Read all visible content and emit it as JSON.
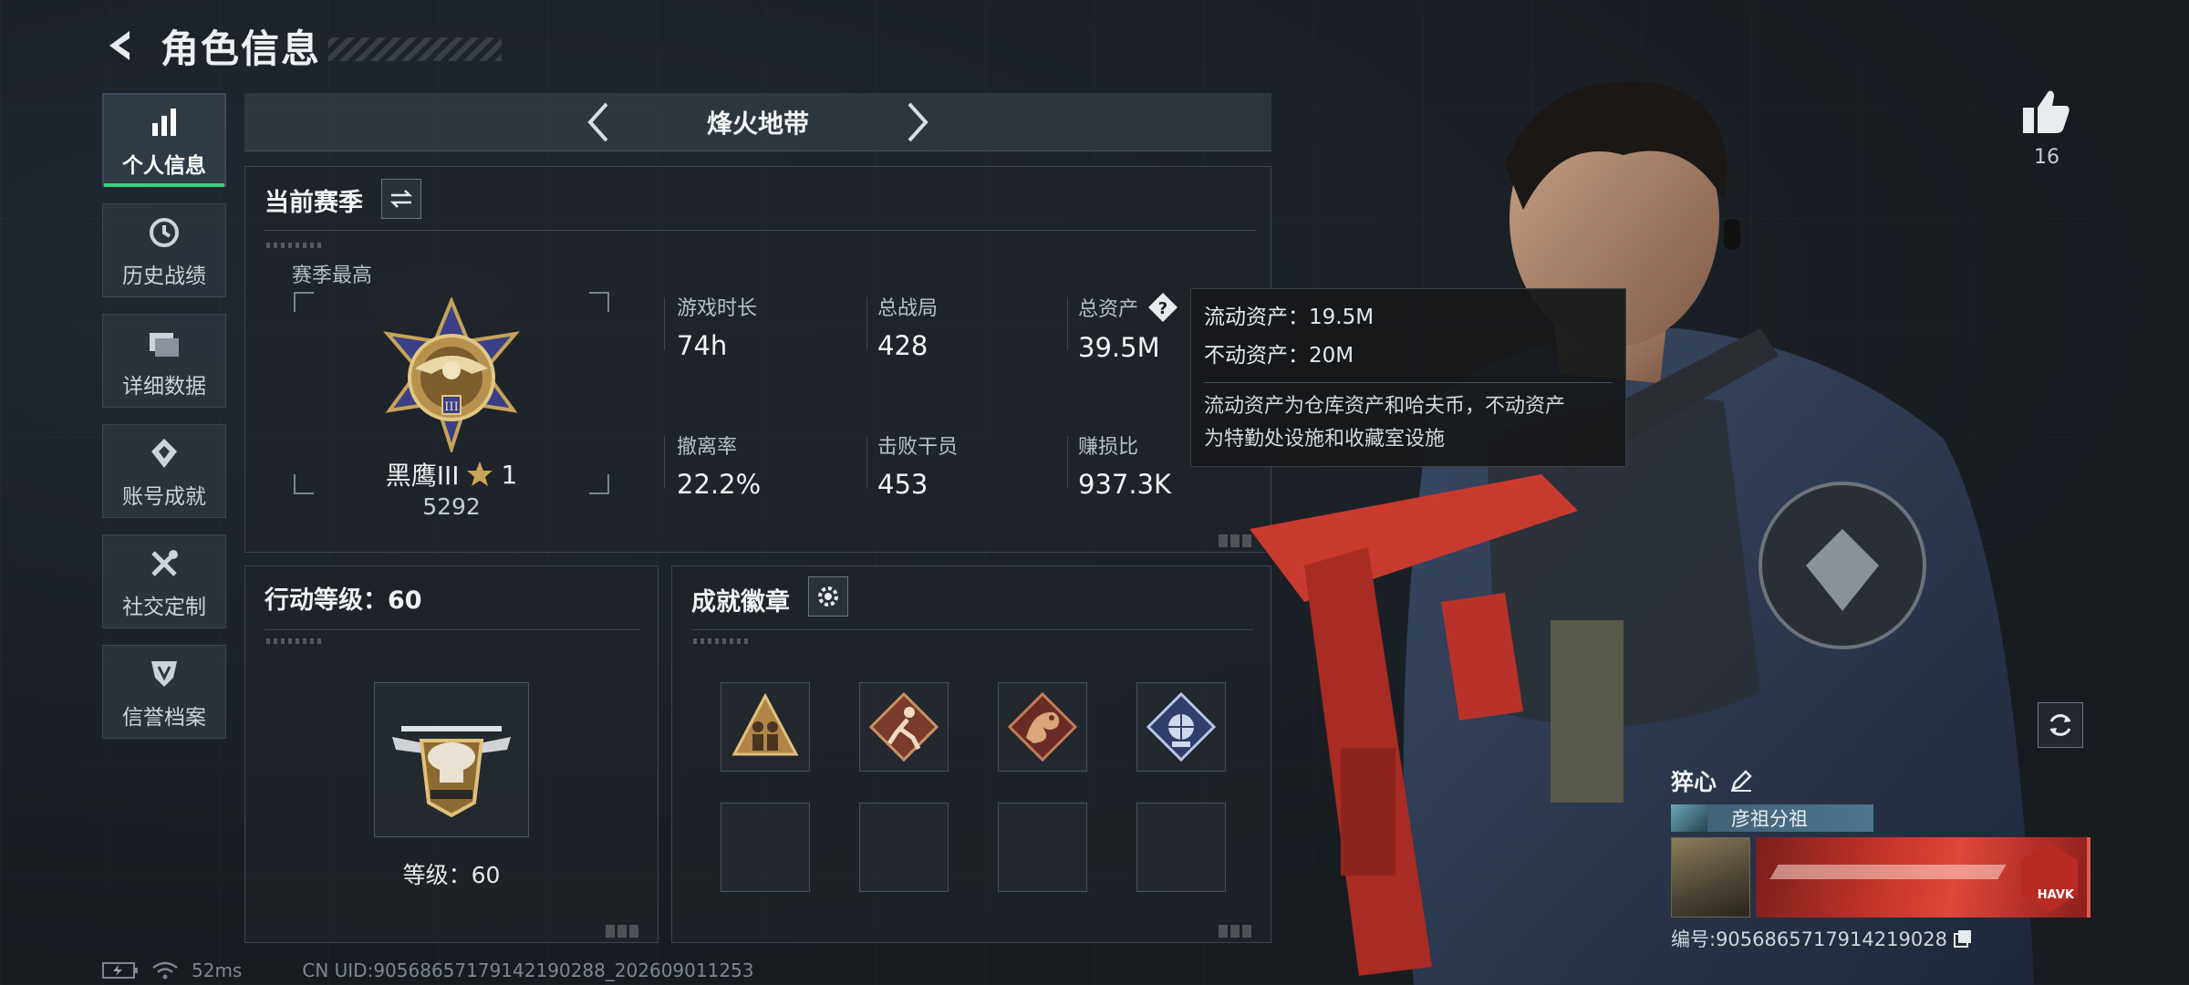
{
  "header": {
    "title": "角色信息"
  },
  "sidebar": {
    "items": [
      {
        "label": "个人信息",
        "icon": "bar-chart-icon",
        "active": true
      },
      {
        "label": "历史战绩",
        "icon": "history-clock-icon"
      },
      {
        "label": "详细数据",
        "icon": "folder-icon"
      },
      {
        "label": "账号成就",
        "icon": "achievement-icon"
      },
      {
        "label": "社交定制",
        "icon": "tools-icon"
      },
      {
        "label": "信誉档案",
        "icon": "shield-icon"
      }
    ]
  },
  "mode": {
    "title": "烽火地带"
  },
  "season": {
    "title": "当前赛季",
    "best_label": "赛季最高",
    "rank_name": "黑鹰III",
    "rank_stars": "1",
    "rank_score": "5292",
    "stats": [
      {
        "label": "游戏时长",
        "value": "74h"
      },
      {
        "label": "总战局",
        "value": "428"
      },
      {
        "label": "总资产",
        "value": "39.5M"
      },
      {
        "label": "撤离率",
        "value": "22.2%"
      },
      {
        "label": "击败干员",
        "value": "453"
      },
      {
        "label": "赚损比",
        "value": "937.3K"
      }
    ]
  },
  "tooltip": {
    "liquid": "流动资产：19.5M",
    "fixed": "不动资产：20M",
    "desc_line1": "流动资产为仓库资产和哈夫币，不动资产",
    "desc_line2": "为特勤处设施和收藏室设施"
  },
  "action_level": {
    "title": "行动等级：60",
    "level_text": "等级：60"
  },
  "achievements": {
    "title": "成就徽章",
    "badges": [
      "triangle-soldiers-badge",
      "runner-badge",
      "dragon-badge",
      "globe-badge",
      "empty",
      "empty",
      "empty",
      "empty"
    ]
  },
  "profile": {
    "likes": "16",
    "player_name": "猝心",
    "team_name": "彦祖分祖",
    "banner_brand": "HAVK",
    "player_id": "编号:9056865717914219028"
  },
  "footer": {
    "ping": "52ms",
    "uid": "CN UID:90568657179142190288_202609011253"
  },
  "colors": {
    "accent_green": "#34d17c",
    "banner_red": "#c8352b",
    "panel_bg": "#1e242a"
  }
}
